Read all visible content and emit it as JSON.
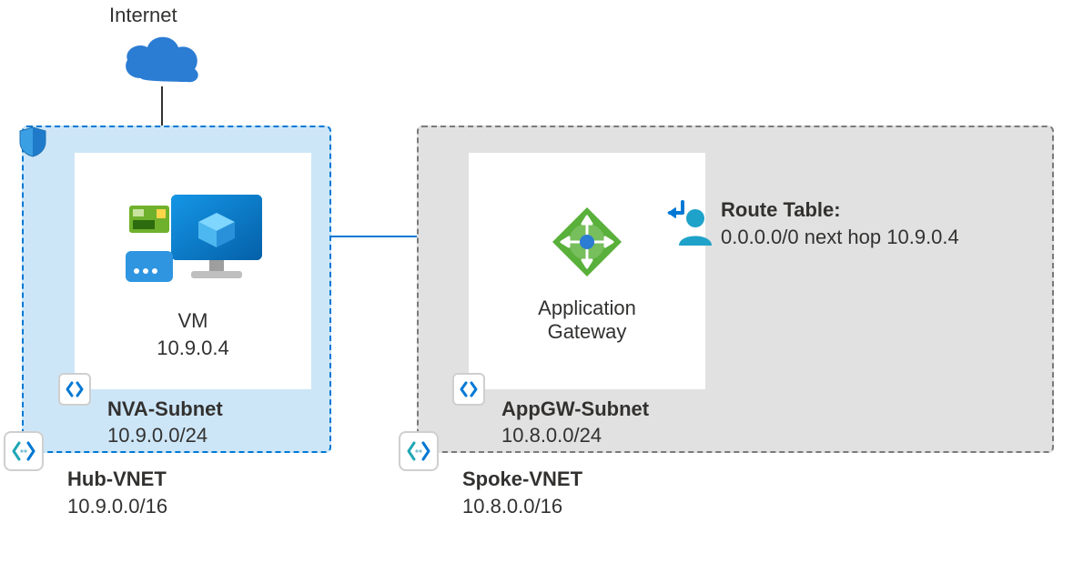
{
  "internet": {
    "label": "Internet"
  },
  "hub_vnet": {
    "name": "Hub-VNET",
    "cidr": "10.9.0.0/16",
    "subnet": {
      "name": "NVA-Subnet",
      "cidr": "10.9.0.0/24",
      "vm": {
        "label": "VM",
        "ip": "10.9.0.4"
      }
    }
  },
  "spoke_vnet": {
    "name": "Spoke-VNET",
    "cidr": "10.8.0.0/16",
    "subnet": {
      "name": "AppGW-Subnet",
      "cidr": "10.8.0.0/24",
      "appgw": {
        "label_line1": "Application",
        "label_line2": "Gateway"
      }
    }
  },
  "route_table": {
    "title": "Route Table:",
    "entry": "0.0.0.0/0 next hop 10.9.0.4"
  },
  "colors": {
    "azure_blue": "#0078d4",
    "hub_fill": "#cde6f7",
    "spoke_fill": "#e1e1e1",
    "green": "#59b03a",
    "teal": "#20a7b5"
  }
}
